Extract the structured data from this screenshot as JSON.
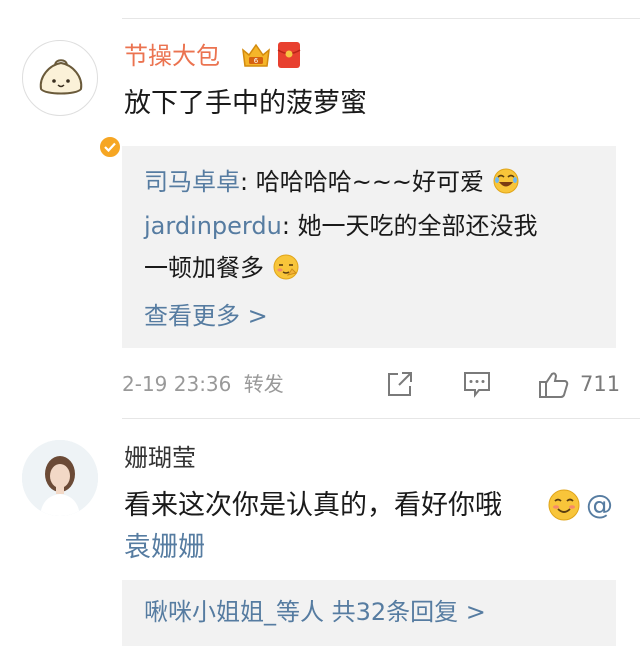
{
  "comment1": {
    "username": "节操大包",
    "text": "放下了手中的菠萝蜜",
    "replies": [
      {
        "author": "司马卓卓",
        "text": ": 哈哈哈哈~~~好可爱"
      },
      {
        "author": "jardinperdu",
        "text": ": 她一天吃的全部还没我",
        "text2": "一顿加餐多"
      }
    ],
    "more_label": "查看更多 >",
    "timestamp": "2-19 23:36",
    "repost_label": "转发",
    "like_count": "711"
  },
  "comment2": {
    "username": "姗瑚莹",
    "text": "看来这次你是认真的，看好你哦",
    "at": "@",
    "mention": "袁姗姗",
    "replies_summary": "啾咪小姐姐_等人 共32条回复 >"
  },
  "colors": {
    "username_orange": "#eb7350",
    "link_blue": "#567ca1",
    "meta_gray": "#999999",
    "reply_bg": "#f2f2f2"
  }
}
